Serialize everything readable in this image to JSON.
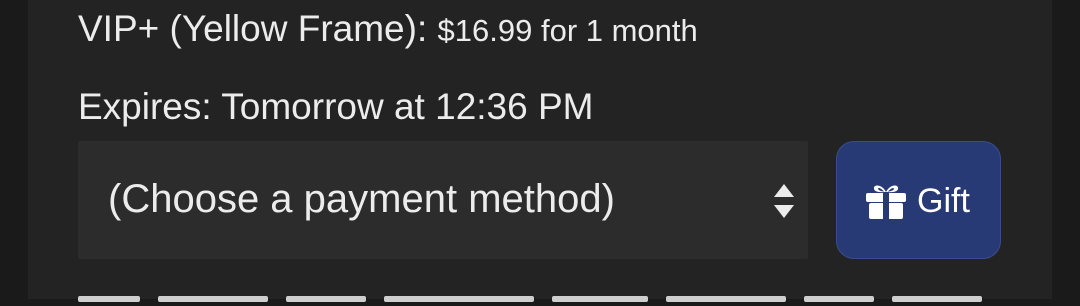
{
  "subscription": {
    "tier_label": "VIP+ (Yellow Frame):",
    "price": "$16.99",
    "duration": "for 1 month",
    "expires_label": "Expires:",
    "expires_value": "Tomorrow at 12:36 PM"
  },
  "payment": {
    "selected_value": "(Choose a payment method)",
    "arrow_icon": "up-down-arrows-icon"
  },
  "gift_button": {
    "label": "Gift",
    "icon": "gift-icon",
    "color": "#283a75"
  }
}
